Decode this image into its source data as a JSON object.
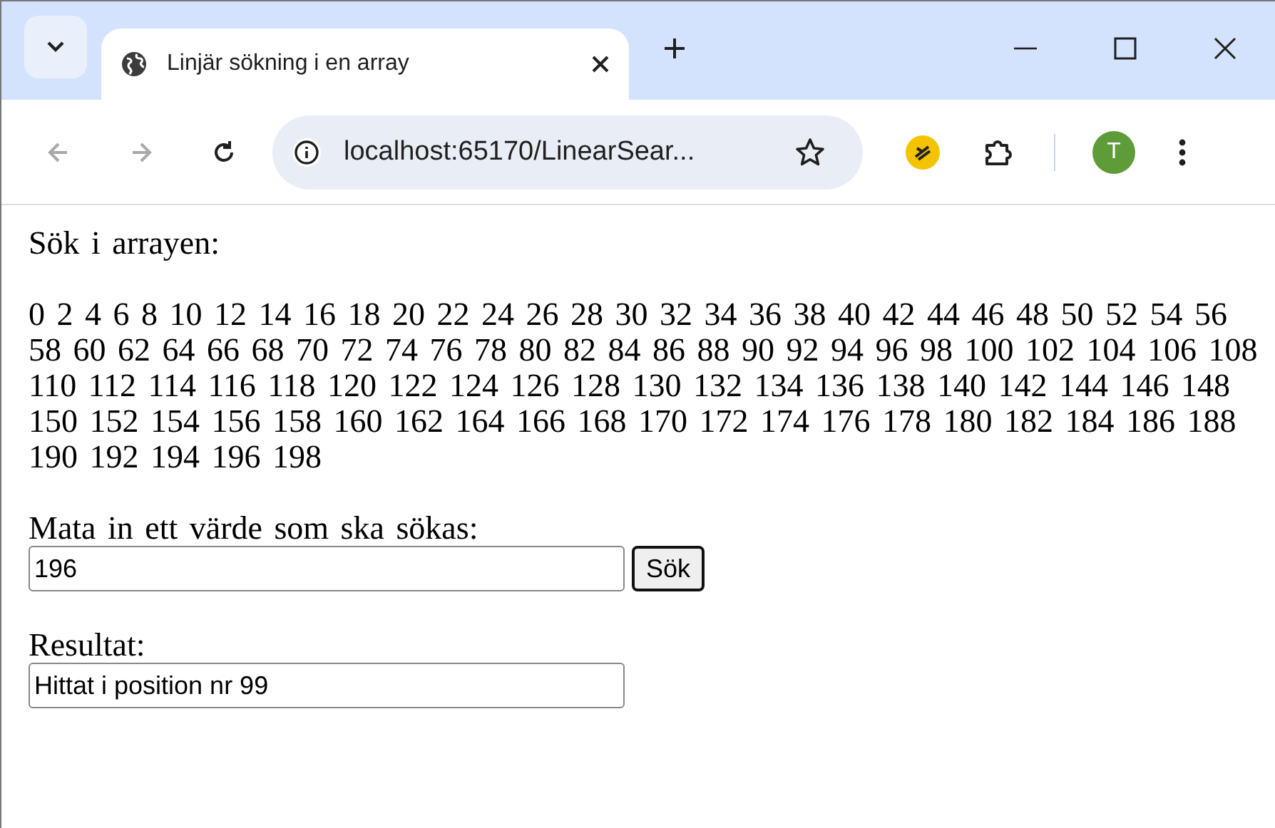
{
  "browser": {
    "tab": {
      "title": "Linjär sökning i en array",
      "selected": true
    },
    "url": "localhost:65170/LinearSear...",
    "nav": [
      {
        "kind": "back",
        "disabled": true
      },
      {
        "kind": "forward",
        "disabled": true
      },
      {
        "kind": "reload",
        "disabled": false
      }
    ],
    "avatar": "T"
  },
  "page": {
    "heading": "Sök i arrayen:",
    "array_text": "0 2 4 6 8 10 12 14 16 18 20 22 24 26 28 30 32 34 36 38 40 42 44 46 48 50 52 54 56 58 60 62 64 66 68 70 72 74 76 78 80 82 84 86 88 90 92 94 96 98 100 102 104 106 108 110 112 114 116 118 120 122 124 126 128 130 132 134 136 138 140 142 144 146 148 150 152 154 156 158 160 162 164 166 168 170 172 174 176 178 180 182 184 186 188 190 192 194 196 198",
    "search_label": "Mata in ett värde som ska sökas:",
    "search_value": "196",
    "search_button": "Sök",
    "result_label": "Resultat:",
    "result_value": "Hittat i position nr 99"
  }
}
